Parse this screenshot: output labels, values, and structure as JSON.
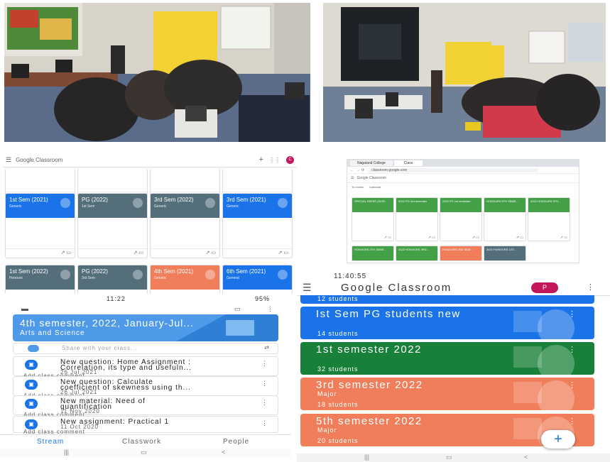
{
  "colors": {
    "gc_green": "#188038",
    "gc_blue": "#1a73e8",
    "gc_orange": "#f07e5b",
    "gc_gray": "#546e7a",
    "gc_teal": "#129eaf"
  },
  "desktop_grid": {
    "app_title": "Google Classroom",
    "avatar_letter": "C",
    "top_cards": [
      {
        "title": "1st Sem (2021)",
        "subtitle": "Generic",
        "color": "#1a73e8"
      },
      {
        "title": "PG (2022)",
        "subtitle": "1st Sem",
        "color": "#546e7a"
      },
      {
        "title": "3rd Sem (2022)",
        "subtitle": "Generic",
        "color": "#546e7a"
      },
      {
        "title": "3rd Sem (2021)",
        "subtitle": "Generic",
        "color": "#1a73e8"
      }
    ],
    "bottom_cards": [
      {
        "title": "1st Sem (2022)",
        "subtitle": "Honours",
        "color": "#546e7a"
      },
      {
        "title": "PG (2022)",
        "subtitle": "3rd Sem",
        "color": "#546e7a"
      },
      {
        "title": "4th Sem (2021)",
        "subtitle": "Generic",
        "color": "#f07e5b"
      },
      {
        "title": "6th Sem (2021)",
        "subtitle": "General",
        "color": "#1a73e8"
      }
    ]
  },
  "browser_grid": {
    "tab1": "Nagaland College",
    "tab2": "Class",
    "address": "classroom.google.com",
    "app_title": "Google Classroom",
    "nav_home": "To review",
    "nav_calendar": "Calendar",
    "row1": [
      {
        "title": "SPECIAL PAPER (SIGE...",
        "color": "#43a047"
      },
      {
        "title": "2022 PG 3rd semester",
        "color": "#43a047"
      },
      {
        "title": "2022 PG 1st semester",
        "color": "#43a047"
      },
      {
        "title": "HONOURS 6TH SEME...",
        "color": "#43a047"
      },
      {
        "title": "2022 HONOURS 5TH...",
        "color": "#43a047"
      }
    ],
    "row2": [
      {
        "title": "HONOURS 4TH SEME...",
        "color": "#43a047"
      },
      {
        "title": "2022 HONOURS 3RD...",
        "color": "#43a047"
      },
      {
        "title": "HONOURS 2ND SEM...",
        "color": "#f07e5b"
      },
      {
        "title": "2022 HONOURS 1ST...",
        "color": "#546e7a"
      }
    ]
  },
  "phone_stream": {
    "status_time": "11:22",
    "status_battery": "95%",
    "class_title": "4th semester, 2022, January-Jul...",
    "class_subtitle": "Arts and Science",
    "share_placeholder": "Share with your class...",
    "posts": [
      {
        "title": "New question: Home Assignment :",
        "title2": "Correlation, its type and usefuln...",
        "date": "26 Jul 2021",
        "comment": "Add class comment"
      },
      {
        "title": "New question: Calculate",
        "title2": "coefficient of skewness using th...",
        "date": "26 Jul 2021",
        "comment": "Add class comment"
      },
      {
        "title": "New material: Need of",
        "title2": "quantification",
        "date": "11 Nov 2020",
        "comment": "Add class comment"
      },
      {
        "title": "New assignment: Practical 1",
        "title2": "",
        "date": "11 Oct 2020",
        "comment": "Add class comment"
      }
    ],
    "nav": {
      "stream": "Stream",
      "classwork": "Classwork",
      "people": "People"
    }
  },
  "phone_classes": {
    "status_time": "11:40:55",
    "app_title": "Google Classroom",
    "avatar_letter": "P",
    "top_partial": "12 students",
    "cards": [
      {
        "title": "Ist Sem PG students new",
        "subtitle": "",
        "students": "14 students",
        "color": "#1a73e8"
      },
      {
        "title": "1st semester 2022",
        "subtitle": "",
        "students": "32 students",
        "color": "#188038"
      },
      {
        "title": "3rd semester 2022",
        "subtitle": "Major",
        "students": "18 students",
        "color": "#f07e5b"
      },
      {
        "title": "5th semester 2022",
        "subtitle": "Major",
        "students": "20 students",
        "color": "#f07e5b"
      }
    ],
    "fab": "+"
  }
}
